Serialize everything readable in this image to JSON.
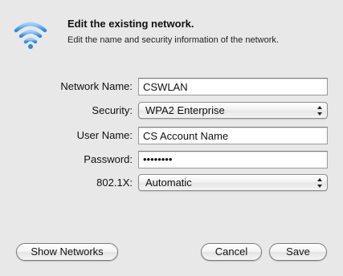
{
  "header": {
    "icon": "wifi-icon",
    "title": "Edit the existing network.",
    "subtitle": "Edit the name and security information of the network."
  },
  "form": {
    "network_name": {
      "label": "Network Name:",
      "value": "CSWLAN"
    },
    "security": {
      "label": "Security:",
      "selected": "WPA2 Enterprise"
    },
    "user_name": {
      "label": "User Name:",
      "value": "CS Account Name"
    },
    "password": {
      "label": "Password:",
      "masked": "••••••••"
    },
    "dot1x": {
      "label": "802.1X:",
      "selected": "Automatic"
    }
  },
  "buttons": {
    "show_networks": "Show Networks",
    "cancel": "Cancel",
    "save": "Save"
  },
  "colors": {
    "background": "#e8e8e8",
    "wifi_blue": "#3a8ee0"
  }
}
